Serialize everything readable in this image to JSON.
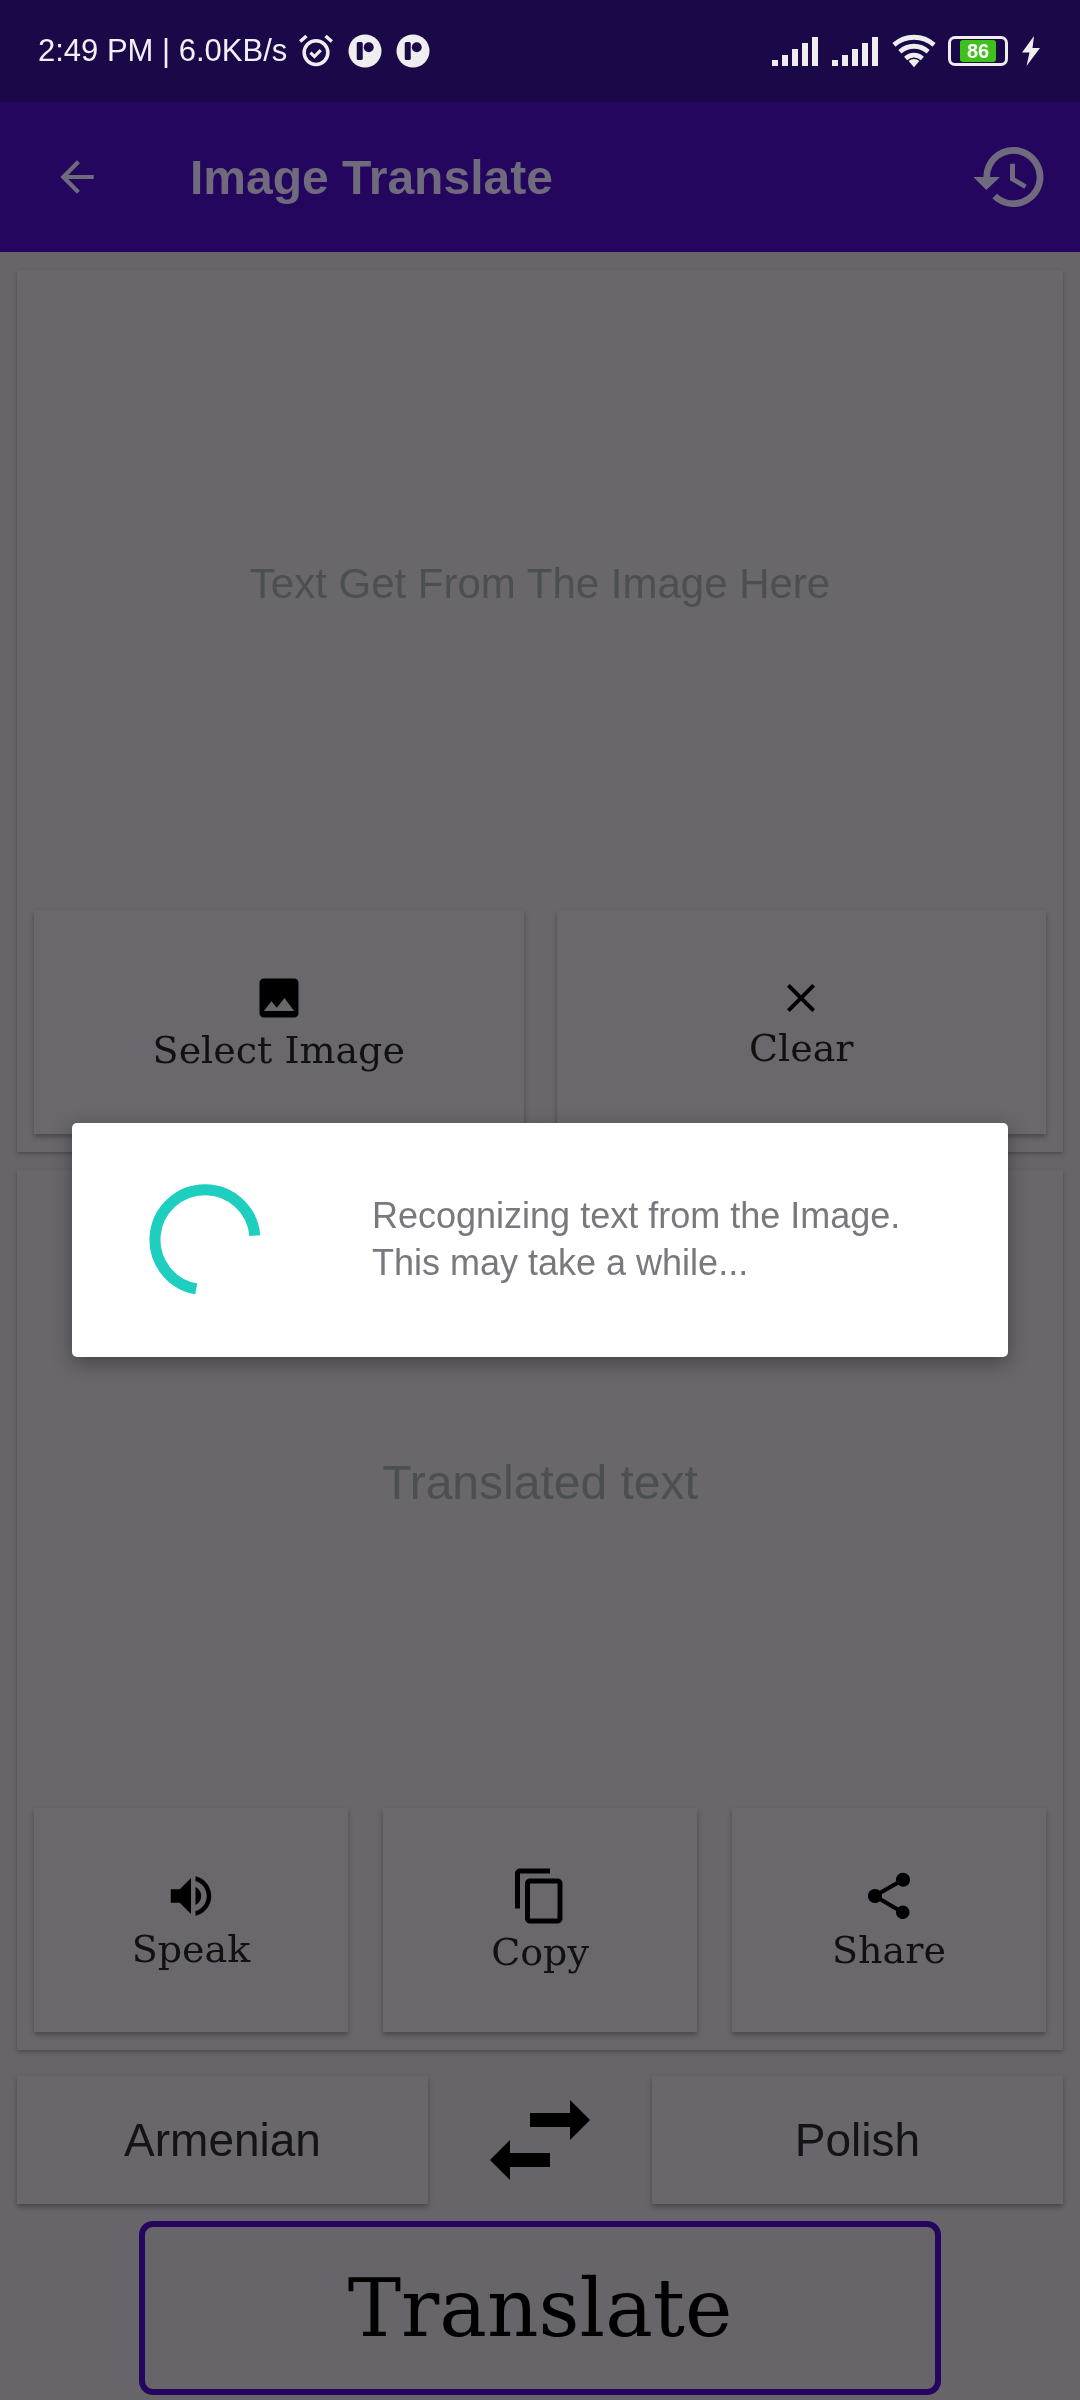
{
  "status_bar": {
    "time": "2:49 PM | 6.0KB/s",
    "battery": "86"
  },
  "app_bar": {
    "title": "Image Translate"
  },
  "source_panel": {
    "placeholder": "Text Get From The Image Here",
    "buttons": [
      {
        "kind": "image",
        "label": "Select Image"
      },
      {
        "kind": "clear",
        "label": "Clear"
      }
    ]
  },
  "result_panel": {
    "placeholder": "Translated text",
    "buttons": [
      {
        "kind": "speak",
        "label": "Speak"
      },
      {
        "kind": "copy",
        "label": "Copy"
      },
      {
        "kind": "share",
        "label": "Share"
      }
    ]
  },
  "languages": {
    "source": "Armenian",
    "target": "Polish"
  },
  "translate_button": {
    "label": "Translate"
  },
  "dialog": {
    "message": "Recognizing text from the Image.\nThis may take a while..."
  }
}
